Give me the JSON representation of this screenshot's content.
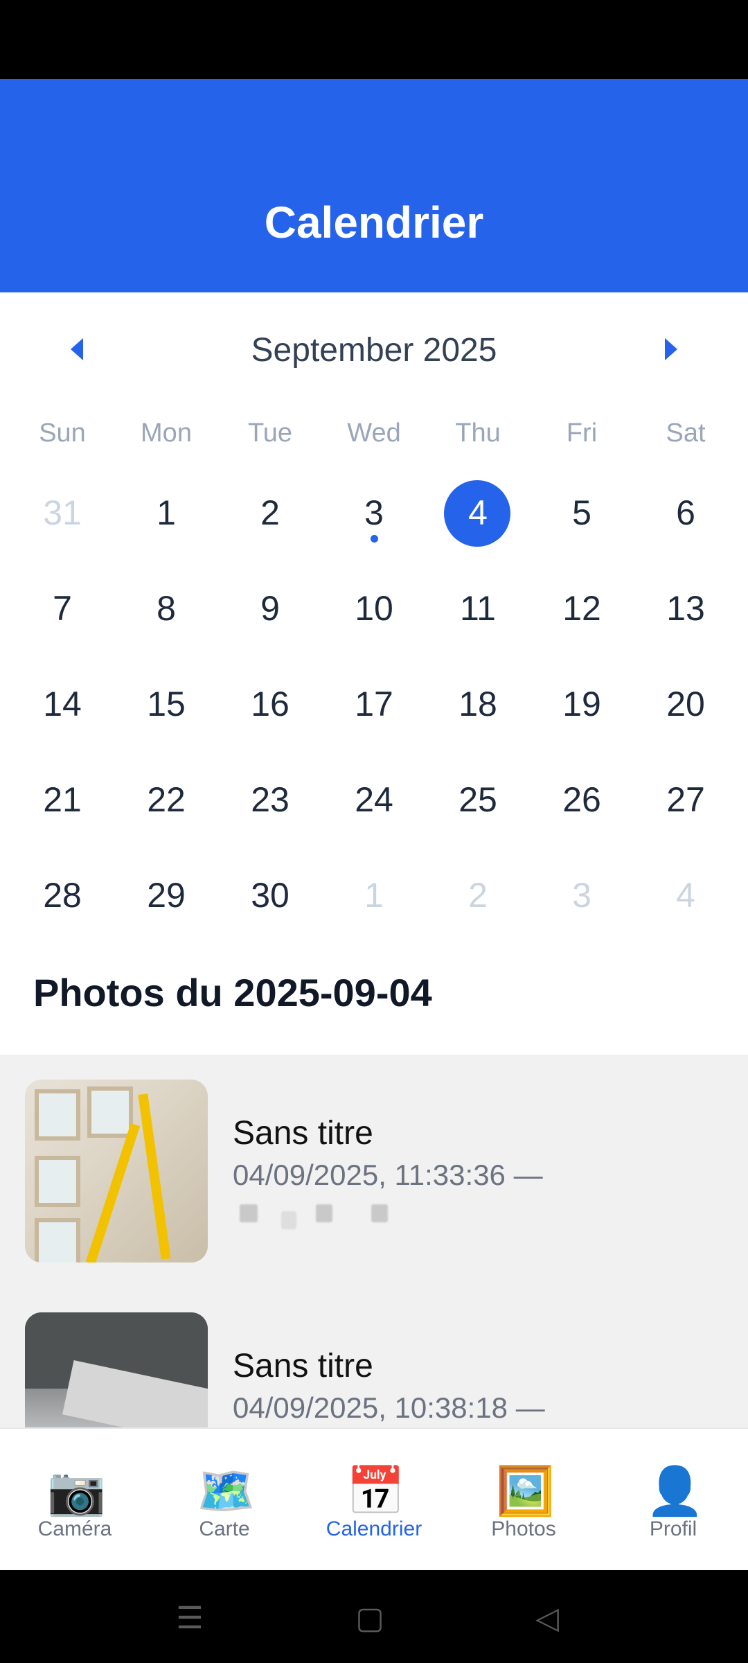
{
  "header": {
    "title": "Calendrier"
  },
  "calendar": {
    "month_label": "September 2025",
    "weekdays": [
      "Sun",
      "Mon",
      "Tue",
      "Wed",
      "Thu",
      "Fri",
      "Sat"
    ],
    "weeks": [
      [
        "31",
        "1",
        "2",
        "3",
        "4",
        "5",
        "6"
      ],
      [
        "7",
        "8",
        "9",
        "10",
        "11",
        "12",
        "13"
      ],
      [
        "14",
        "15",
        "16",
        "17",
        "18",
        "19",
        "20"
      ],
      [
        "21",
        "22",
        "23",
        "24",
        "25",
        "26",
        "27"
      ],
      [
        "28",
        "29",
        "30",
        "1",
        "2",
        "3",
        "4"
      ]
    ],
    "selected_day": "4",
    "accent_color": "#2563eb"
  },
  "photos": {
    "title": "Photos du 2025-09-04",
    "items": [
      {
        "title": "Sans titre",
        "subtitle": "04/09/2025, 11:33:36 —"
      },
      {
        "title": "Sans titre",
        "subtitle": "04/09/2025, 10:38:18 —"
      }
    ]
  },
  "tabbar": {
    "tabs": [
      {
        "label": "Caméra",
        "icon": "📷",
        "icon_name": "camera-icon"
      },
      {
        "label": "Carte",
        "icon": "🗺️",
        "icon_name": "map-icon"
      },
      {
        "label": "Calendrier",
        "icon": "📅",
        "icon_name": "calendar-icon",
        "active": true
      },
      {
        "label": "Photos",
        "icon": "🖼️",
        "icon_name": "picture-icon"
      },
      {
        "label": "Profil",
        "icon": "👤",
        "icon_name": "profile-icon"
      }
    ]
  }
}
